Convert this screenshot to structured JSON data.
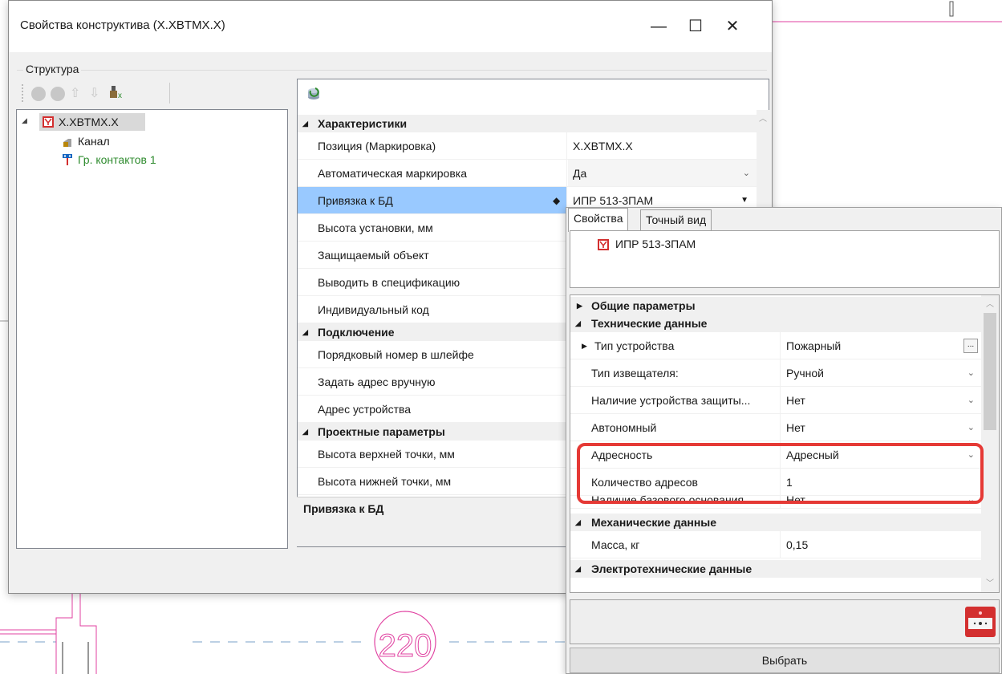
{
  "window": {
    "title": "Свойства конструктива (X.XBTMX.X)",
    "minimize": "—",
    "maximize": "☐",
    "close": "✕"
  },
  "structure": {
    "group_label": "Структура",
    "toolbar_icons": [
      "add-icon",
      "remove-icon",
      "move-up-icon",
      "move-down-icon",
      "delete-contacts-icon"
    ],
    "tree": {
      "root": "X.XBTMX.X",
      "children": [
        "Канал",
        "Гр. контактов 1"
      ]
    }
  },
  "properties": {
    "refresh_icon": "refresh-icon",
    "categories": [
      {
        "label": "Характеристики",
        "rows": [
          {
            "name": "Позиция (Маркировка)",
            "value": "X.XBTMX.X"
          },
          {
            "name": "Автоматическая маркировка",
            "value": "Да"
          },
          {
            "name": "Привязка к БД",
            "value": "ИПР 513-3ПАМ"
          },
          {
            "name": "Высота установки, мм",
            "value": ""
          },
          {
            "name": "Защищаемый объект",
            "value": ""
          },
          {
            "name": "Выводить в спецификацию",
            "value": ""
          },
          {
            "name": "Индивидуальный код",
            "value": ""
          }
        ]
      },
      {
        "label": "Подключение",
        "rows": [
          {
            "name": "Порядковый номер в шлейфе",
            "value": ""
          },
          {
            "name": "Задать адрес вручную",
            "value": ""
          },
          {
            "name": "Адрес устройства",
            "value": ""
          }
        ]
      },
      {
        "label": "Проектные параметры",
        "rows": [
          {
            "name": "Высота верхней точки, мм",
            "value": ""
          },
          {
            "name": "Высота нижней точки, мм",
            "value": ""
          }
        ]
      }
    ],
    "description_title": "Привязка к БД"
  },
  "popup": {
    "tabs": [
      "Свойства",
      "Точный вид"
    ],
    "device_name": "ИПР 513-3ПАМ",
    "cat_general": "Общие параметры",
    "cat_technical": "Технические данные",
    "tech_rows": [
      {
        "name": "Тип устройства",
        "value": "Пожарный"
      },
      {
        "name": "Тип извещателя:",
        "value": "Ручной"
      },
      {
        "name": "Наличие устройства защиты...",
        "value": "Нет"
      },
      {
        "name": "Автономный",
        "value": "Нет"
      },
      {
        "name": "Адресность",
        "value": "Адресный"
      },
      {
        "name": "Количество адресов",
        "value": "1"
      },
      {
        "name": "Наличие базового основания",
        "value": "Нет"
      }
    ],
    "cat_mechanical": "Механические данные",
    "mech_rows": [
      {
        "name": "Масса, кг",
        "value": "0,15"
      }
    ],
    "cat_electrical": "Электротехнические данные",
    "select_button": "Выбрать"
  },
  "drawing": {
    "circle_label": "220"
  },
  "colors": {
    "selection": "#99c9ff",
    "highlight": "#e53935",
    "cad_line": "#e040a0",
    "green_text": "#2e8b2e"
  }
}
